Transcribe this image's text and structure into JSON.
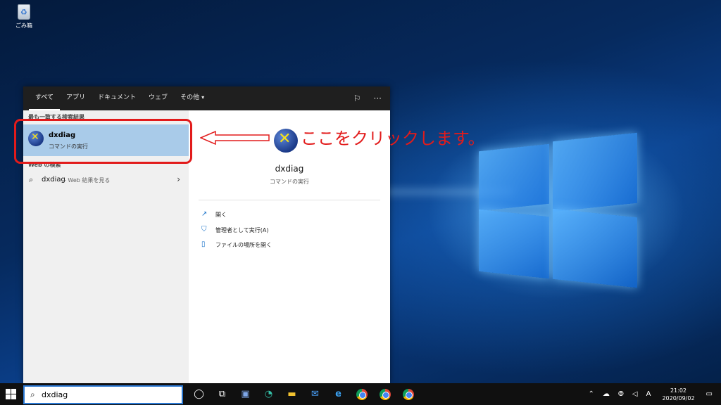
{
  "desktop": {
    "recycle_bin_label": "ごみ箱"
  },
  "search_panel": {
    "tabs": [
      "すべて",
      "アプリ",
      "ドキュメント",
      "ウェブ",
      "その他"
    ],
    "more_caret": "▾",
    "top_icons": [
      "feedback-icon",
      "more-options-icon"
    ],
    "more_glyph": "···",
    "best_match_label": "最も一致する検索結果",
    "best_match": {
      "name": "dxdiag",
      "subtitle": "コマンドの実行"
    },
    "web_section_label": "Web の検索",
    "web_result": {
      "query": "dxdiag",
      "hint": "- Web 結果を見る"
    },
    "detail": {
      "name": "dxdiag",
      "subtitle": "コマンドの実行",
      "actions": [
        {
          "label": "開く",
          "icon": "open-icon"
        },
        {
          "label": "管理者として実行(A)",
          "icon": "run-as-admin-icon"
        },
        {
          "label": "ファイルの場所を開く",
          "icon": "open-file-location-icon"
        }
      ]
    }
  },
  "annotation": {
    "callout_text": "ここをクリックします。",
    "color": "#e21b1b"
  },
  "taskbar": {
    "search_value": "dxdiag",
    "tray": {
      "ime": "A",
      "time": "21:02",
      "date": "2020/09/02"
    }
  },
  "colors": {
    "accent": "#2b79d4",
    "selection": "#a9cbe9",
    "taskbar": "#101010"
  }
}
